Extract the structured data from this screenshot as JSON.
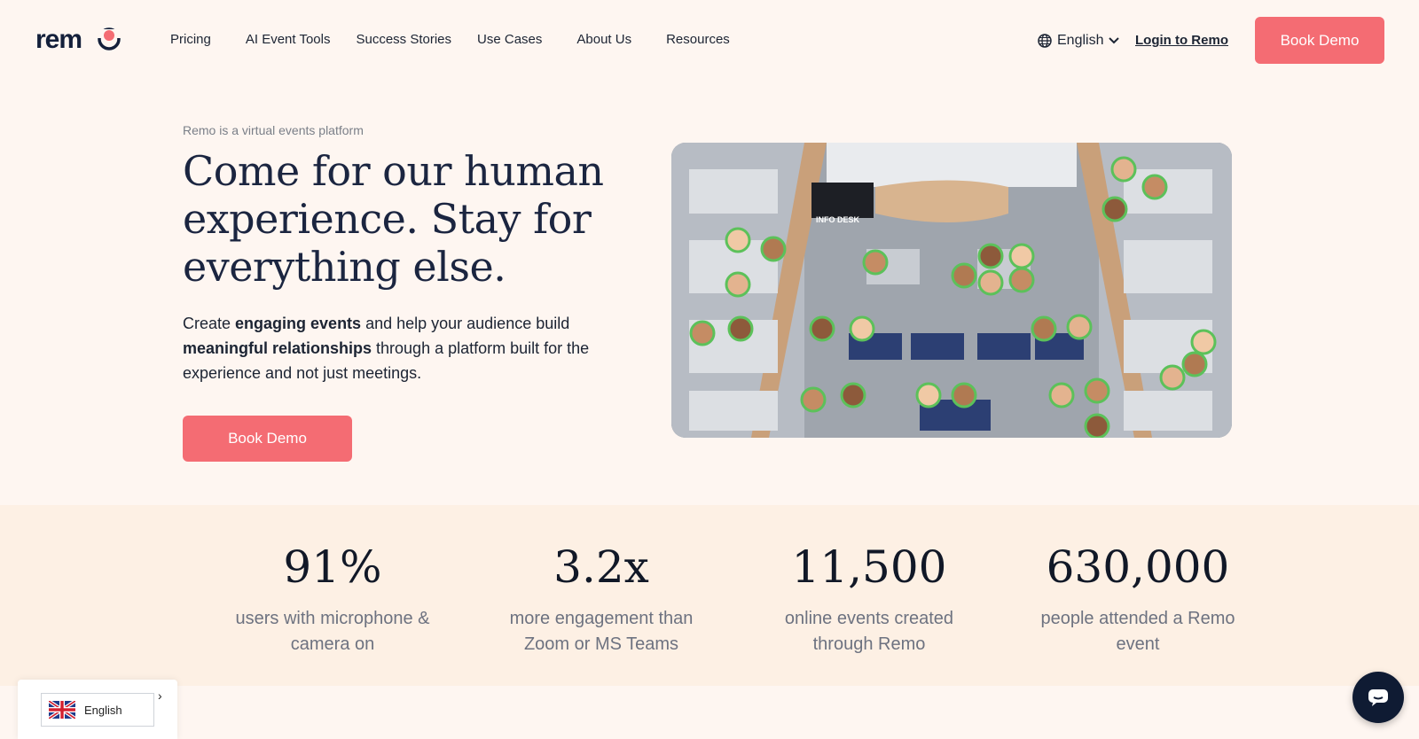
{
  "header": {
    "logo_text": "remo",
    "nav": [
      {
        "label": "Pricing"
      },
      {
        "label": "AI Event Tools"
      },
      {
        "label": "Success Stories"
      },
      {
        "label": "Use Cases"
      },
      {
        "label": "About Us"
      },
      {
        "label": "Resources"
      }
    ],
    "language": "English",
    "login_label": "Login to Remo",
    "cta_label": "Book Demo"
  },
  "hero": {
    "eyebrow": "Remo is a virtual events platform",
    "headline": "Come for our human experience. Stay for everything else.",
    "sub_prefix": "Create ",
    "sub_bold1": "engaging events",
    "sub_mid": " and help your audience build ",
    "sub_bold2": "meaningful relationships",
    "sub_suffix": " through a platform built for the experience and not just meetings.",
    "cta_label": "Book Demo",
    "image_sign": "INFO DESK"
  },
  "stats": [
    {
      "value": "91%",
      "label": "users with microphone & camera on"
    },
    {
      "value": "3.2x",
      "label": "more engagement than Zoom or MS Teams"
    },
    {
      "value": "11,500",
      "label": "online events created through Remo"
    },
    {
      "value": "630,000",
      "label": "people attended a Remo event"
    }
  ],
  "language_widget": {
    "label": "English"
  },
  "colors": {
    "accent": "#f46c73",
    "navy": "#14203b",
    "background": "#fef6f1",
    "stats_band": "#fdf0e4"
  }
}
